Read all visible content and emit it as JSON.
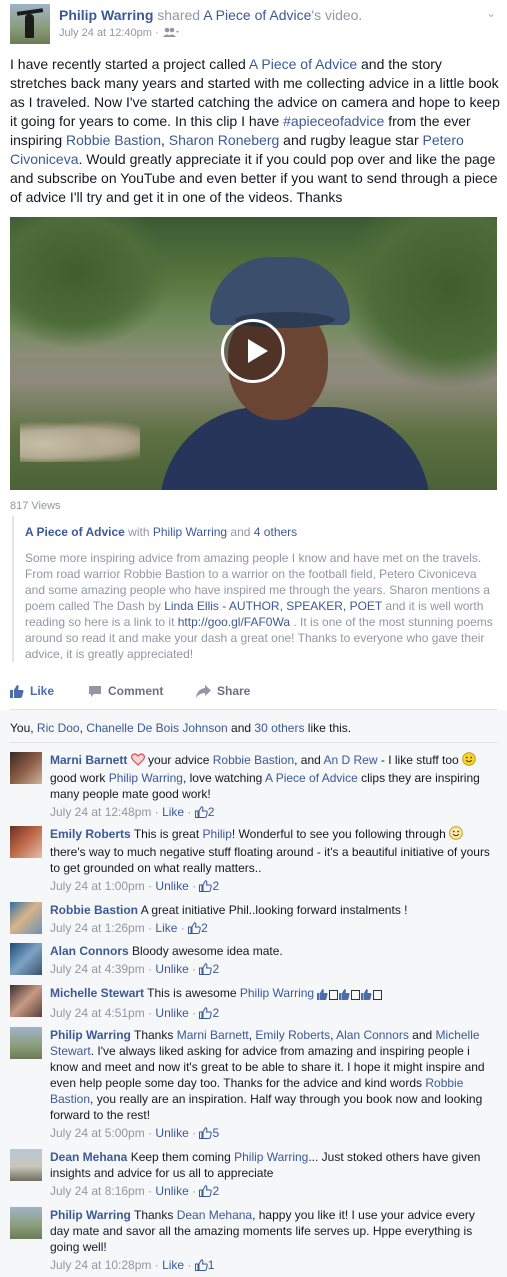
{
  "post": {
    "author": "Philip Warring",
    "shared": "shared",
    "page": "A Piece of Advice",
    "shared_suffix": "'s video.",
    "timestamp": "July 24 at 12:40pm",
    "sep": " · ",
    "body": [
      {
        "t": "I have recently started a project called "
      },
      {
        "t": "A Piece of Advice",
        "link": true
      },
      {
        "t": " and the story stretches back many years and started with me collecting advice in a little book as I traveled. Now I've started catching the advice on camera and hope to keep it going for years to come. In this clip I have "
      },
      {
        "t": "#apieceofadvice",
        "link": true
      },
      {
        "t": " from the ever inspiring "
      },
      {
        "t": "Robbie Bastion",
        "link": true
      },
      {
        "t": ", "
      },
      {
        "t": "Sharon Roneberg",
        "link": true
      },
      {
        "t": " and rugby league star "
      },
      {
        "t": "Petero Civoniceva",
        "link": true
      },
      {
        "t": ". Would greatly appreciate it if you could pop over and like the page and subscribe on YouTube and even better if you want to send through a piece of advice I'll try and get it in one of the videos. Thanks"
      }
    ]
  },
  "video": {
    "views": "817 Views"
  },
  "attachment": {
    "source": "A Piece of Advice",
    "with_text": " with ",
    "with_name": "Philip Warring",
    "and_text": " and ",
    "others": "4 others",
    "description": [
      {
        "t": "Some more inspiring advice from amazing people I know and have met on the travels. From road warrior Robbie Bastion to a warrior on the football field, Petero Civoniceva and some amazing people who have inspired me through the years. Sharon mentions a poem called The Dash by "
      },
      {
        "t": "Linda Ellis - AUTHOR, SPEAKER, POET",
        "link": true
      },
      {
        "t": " and it is well worth reading so here is a link to it "
      },
      {
        "t": "http://goo.gl/FAF0Wa",
        "link": true
      },
      {
        "t": " . It is one of the most stunning poems around so read it and make your dash a great one! Thanks to everyone who gave their advice, it is greatly appreciated!"
      }
    ]
  },
  "actions": {
    "like": "Like",
    "comment": "Comment",
    "share": "Share"
  },
  "likes": {
    "parts": [
      {
        "t": "You, "
      },
      {
        "t": "Ric Doo",
        "link": true
      },
      {
        "t": ", "
      },
      {
        "t": "Chanelle De Bois Johnson",
        "link": true
      },
      {
        "t": " and "
      },
      {
        "t": "30 others",
        "link": true
      },
      {
        "t": " like this."
      }
    ]
  },
  "comments": [
    {
      "name": "Marni Barnett",
      "parts": [
        {
          "t": " "
        },
        {
          "t": "♡",
          "emoji": "heart"
        },
        {
          "t": " your advice "
        },
        {
          "t": "Robbie Bastion",
          "link": true
        },
        {
          "t": ", and "
        },
        {
          "t": "An D Rew",
          "link": true
        },
        {
          "t": " - I like stuff too "
        },
        {
          "t": "☺",
          "emoji": "smile"
        },
        {
          "t": " good work "
        },
        {
          "t": "Philip Warring",
          "link": true
        },
        {
          "t": ", love watching "
        },
        {
          "t": "A Piece of Advice",
          "link": true
        },
        {
          "t": " clips they are inspiring many people mate good work!"
        }
      ],
      "time": "July 24 at 12:48pm",
      "action": "Like",
      "count": "2"
    },
    {
      "name": "Emily Roberts",
      "parts": [
        {
          "t": " This is great "
        },
        {
          "t": "Philip",
          "link": true
        },
        {
          "t": "! Wonderful to see you following through "
        },
        {
          "t": "☺",
          "emoji": "blush"
        },
        {
          "t": " there's way to much negative stuff floating around - it's a beautiful initiative of yours to get grounded on what really matters.."
        }
      ],
      "time": "July 24 at 1:00pm",
      "action": "Unlike",
      "count": "2"
    },
    {
      "name": "Robbie Bastion",
      "parts": [
        {
          "t": " A great initiative Phil..looking forward instalments !"
        }
      ],
      "time": "July 24 at 1:26pm",
      "action": "Like",
      "count": "2"
    },
    {
      "name": "Alan Connors",
      "parts": [
        {
          "t": " Bloody awesome idea mate."
        }
      ],
      "time": "July 24 at 4:39pm",
      "action": "Unlike",
      "count": "2"
    },
    {
      "name": "Michelle Stewart",
      "parts": [
        {
          "t": " This is awesome "
        },
        {
          "t": "Philip Warring",
          "link": true
        },
        {
          "t": " "
        },
        {
          "t": "",
          "emoji": "thumbsquares"
        }
      ],
      "time": "July 24 at 4:51pm",
      "action": "Unlike",
      "count": "2"
    },
    {
      "name": "Philip Warring",
      "parts": [
        {
          "t": " Thanks "
        },
        {
          "t": "Marni Barnett",
          "link": true
        },
        {
          "t": ", "
        },
        {
          "t": "Emily Roberts",
          "link": true
        },
        {
          "t": ", "
        },
        {
          "t": "Alan Connors",
          "link": true
        },
        {
          "t": " and "
        },
        {
          "t": "Michelle Stewart",
          "link": true
        },
        {
          "t": ". I've always liked asking for advice from amazing and inspiring people i know and meet and now it's great to be able to share it. I hope it might inspire and even help people some day too. Thanks for the advice and kind words "
        },
        {
          "t": "Robbie Bastion",
          "link": true
        },
        {
          "t": ", you really are an inspiration. Half way through you book now and looking forward to the rest!"
        }
      ],
      "time": "July 24 at 5:00pm",
      "action": "Unlike",
      "count": "5"
    },
    {
      "name": "Dean Mehana",
      "parts": [
        {
          "t": " Keep them coming "
        },
        {
          "t": "Philip Warring",
          "link": true
        },
        {
          "t": "... Just stoked others have given insights and advice for us all to appreciate"
        }
      ],
      "time": "July 24 at 8:16pm",
      "action": "Unlike",
      "count": "2"
    },
    {
      "name": "Philip Warring",
      "parts": [
        {
          "t": " Thanks "
        },
        {
          "t": "Dean Mehana",
          "link": true
        },
        {
          "t": ", happy you like it! I use your advice every day mate and savor all the amazing moments life serves up. Hppe everything is going well!"
        }
      ],
      "time": "July 24 at 10:28pm",
      "action": "Like",
      "count": "1"
    }
  ],
  "colors": {
    "link": "#3b5998",
    "meta": "#9197a3",
    "ufi_bg": "#f6f7f9"
  },
  "icons": {
    "audience": "friends-icon",
    "like": "thumbs-up-icon",
    "comment": "speech-bubble-icon",
    "share": "share-arrow-icon"
  }
}
